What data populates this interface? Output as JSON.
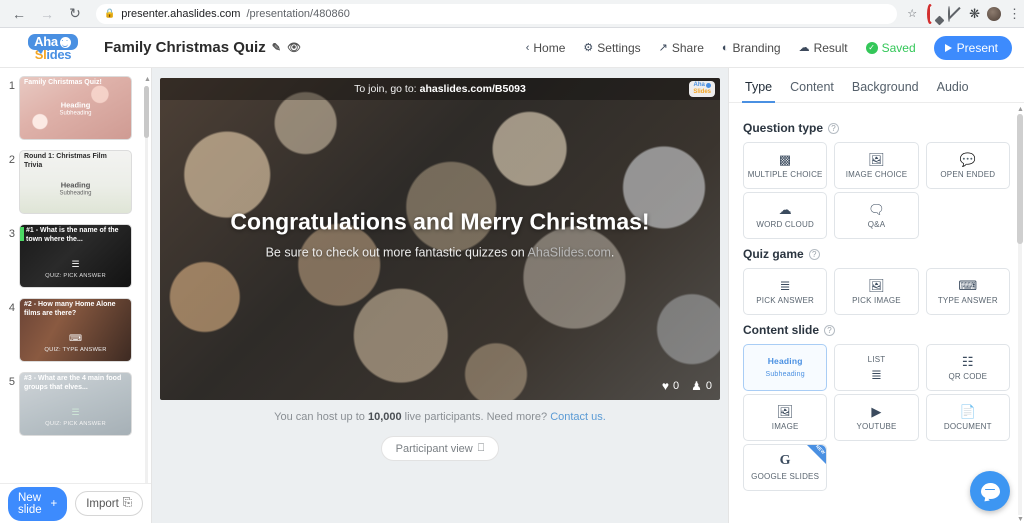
{
  "browser": {
    "back_icon": "arrow-left-icon",
    "forward_icon": "arrow-right-icon",
    "reload_icon": "reload-icon",
    "lock_icon": "lock-icon",
    "url_domain": "presenter.ahaslides.com",
    "url_path": "/presentation/480860",
    "star_icon": "star-icon",
    "menu_icon": "kebab-menu-icon"
  },
  "header": {
    "logo_aha": "Aha",
    "logo_slides_first": "Sl",
    "logo_slides_rest": "ides",
    "title": "Family Christmas Quiz",
    "edit_icon": "✎",
    "preview_icon": "%",
    "nav": [
      {
        "label": "Home",
        "glyph": "‹"
      },
      {
        "label": "Settings",
        "glyph": "⚙"
      },
      {
        "label": "Share",
        "glyph": "↱"
      },
      {
        "label": "Branding",
        "glyph": "◔"
      },
      {
        "label": "Result",
        "glyph": "☁"
      }
    ],
    "saved_label": "Saved",
    "saved_color": "#34c759",
    "present_label": "Present",
    "present_color": "#3d8bfd"
  },
  "sidebar": {
    "slides": [
      {
        "number": "1",
        "bg": "bg1",
        "selected": false,
        "title": "Family Christmas Quiz!",
        "title_color": "#ffffff",
        "heading": "Heading",
        "subheading": "Subheading",
        "text_color": "#ffffff",
        "type_label": "",
        "type_icon": "",
        "green_marker": false
      },
      {
        "number": "2",
        "bg": "bg2",
        "selected": false,
        "title": "Round 1: Christmas Film Trivia",
        "title_color": "#2b2b2b",
        "heading": "Heading",
        "subheading": "Subheading",
        "text_color": "#555555",
        "type_label": "",
        "type_icon": "",
        "green_marker": false
      },
      {
        "number": "3",
        "bg": "bg3",
        "selected": false,
        "title": "#1 - What is the name of the town where the...",
        "title_color": "#ffffff",
        "heading": "",
        "subheading": "",
        "text_color": "#ffffff",
        "type_label": "QUIZ: PICK ANSWER",
        "type_icon": "☰",
        "green_marker": true
      },
      {
        "number": "4",
        "bg": "bg4",
        "selected": false,
        "title": "#2 - How many Home Alone films are there?",
        "title_color": "#ffffff",
        "heading": "",
        "subheading": "",
        "text_color": "#e8e8e8",
        "type_label": "QUIZ: TYPE ANSWER",
        "type_icon": "⌨",
        "green_marker": false
      },
      {
        "number": "5",
        "bg": "bg5",
        "selected": false,
        "title": "#3 - What are the 4 main food groups that elves...",
        "title_color": "#ffffff",
        "heading": "",
        "subheading": "",
        "text_color": "#f0f0f0",
        "type_label": "QUIZ: PICK ANSWER",
        "type_icon": "☰",
        "green_marker": false
      }
    ],
    "new_slide_label": "New slide",
    "new_slide_icon": "+",
    "import_label": "Import",
    "import_icon": "⎘"
  },
  "stage": {
    "join_prefix": "To join, go to:",
    "join_code": "ahaslides.com/B5093",
    "badge_aha": "Aha",
    "badge_slides": "Slides",
    "headline": "Congratulations and Merry Christmas!",
    "subline_text": "Be sure to check out more fantastic quizzes on ",
    "subline_link": "AhaSlides.com",
    "subline_end": ".",
    "likes_icon": "♥",
    "likes_count": "0",
    "participants_icon": "♟",
    "participants_count": "0",
    "host_note_pre": "You can host up to ",
    "host_note_number": "10,000",
    "host_note_mid": " live participants. Need more? ",
    "host_note_link": "Contact us.",
    "participant_view_label": "Participant view",
    "participant_view_icon": "⎕"
  },
  "right_panel": {
    "tabs": [
      {
        "label": "Type",
        "active": true
      },
      {
        "label": "Content",
        "active": false
      },
      {
        "label": "Background",
        "active": false
      },
      {
        "label": "Audio",
        "active": false
      }
    ],
    "sections": [
      {
        "title": "Question type",
        "help_icon": "?",
        "cards": [
          {
            "label": "MULTIPLE CHOICE",
            "icon": "▃",
            "icon_name": "bar-chart-icon",
            "selected": false
          },
          {
            "label": "IMAGE CHOICE",
            "icon": "❑",
            "icon_name": "image-icon",
            "selected": false
          },
          {
            "label": "OPEN ENDED",
            "icon": "•••",
            "icon_name": "speech-bubble-icon",
            "selected": false
          },
          {
            "label": "WORD CLOUD",
            "icon": "☁",
            "icon_name": "cloud-icon",
            "selected": false
          },
          {
            "label": "Q&A",
            "icon": "?",
            "icon_name": "question-bubble-icon",
            "selected": false
          }
        ]
      },
      {
        "title": "Quiz game",
        "help_icon": "?",
        "cards": [
          {
            "label": "PICK ANSWER",
            "icon": "☰",
            "icon_name": "list-icon",
            "selected": false
          },
          {
            "label": "PICK IMAGE",
            "icon": "❑",
            "icon_name": "image-icon",
            "selected": false
          },
          {
            "label": "TYPE ANSWER",
            "icon": "⌨",
            "icon_name": "keyboard-icon",
            "selected": false
          }
        ]
      },
      {
        "title": "Content slide",
        "help_icon": "?",
        "cards": [
          {
            "label": "",
            "heading": "Heading",
            "subheading": "Subheading",
            "icon": "",
            "icon_name": "heading-subheading-icon",
            "selected": true
          },
          {
            "label_top": "LIST",
            "icon": "☰",
            "icon_name": "list-icon",
            "selected": false
          },
          {
            "label": "QR CODE",
            "icon": "▒",
            "icon_name": "qr-code-icon",
            "selected": false
          },
          {
            "label": "IMAGE",
            "icon": "❑",
            "icon_name": "image-icon",
            "selected": false
          },
          {
            "label": "YOUTUBE",
            "icon": "▶",
            "icon_name": "youtube-icon",
            "selected": false
          },
          {
            "label": "DOCUMENT",
            "icon": "⎘",
            "icon_name": "document-icon",
            "selected": false
          },
          {
            "label": "GOOGLE SLIDES",
            "icon": "G",
            "icon_name": "google-slides-icon",
            "selected": false,
            "badge": "NEW"
          }
        ]
      }
    ],
    "chat_icon": "chat-bubble-icon",
    "chat_color": "#3d96f2"
  }
}
